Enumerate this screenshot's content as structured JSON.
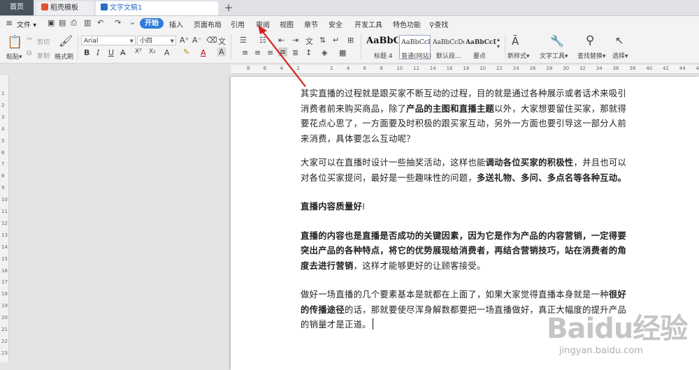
{
  "tabs": {
    "home": "首页",
    "templates": "稻壳模板",
    "document": "文字文稿1",
    "new_tab": "+"
  },
  "menu": {
    "file": "文件",
    "items": [
      "开始",
      "插入",
      "页面布局",
      "引用",
      "审阅",
      "视图",
      "章节",
      "安全",
      "开发工具",
      "特色功能"
    ],
    "search": "查找"
  },
  "ribbon": {
    "paste": "粘贴",
    "cut": "剪切",
    "copy": "复制",
    "format_painter": "格式刷",
    "font_name": "Arial",
    "font_size": "小四",
    "bold": "B",
    "italic": "I",
    "underline": "U",
    "styles": [
      {
        "sample": "AaBbC",
        "label": "标题 4"
      },
      {
        "sample": "AaBbCcD",
        "label": "普通(网站)"
      },
      {
        "sample": "AaBbCcDd",
        "label": "默认段..."
      },
      {
        "sample": "AaBbCcDc",
        "label": "要点"
      }
    ],
    "new_style": "新样式",
    "text_tools": "文字工具",
    "find_replace": "查找替换",
    "select": "选择"
  },
  "ruler": {
    "h_numbers": [
      "8",
      "6",
      "4",
      "2",
      "",
      "2",
      "4",
      "6",
      "8",
      "10",
      "12",
      "14",
      "16",
      "18",
      "20",
      "22",
      "24",
      "26",
      "28",
      "30",
      "32",
      "34",
      "36",
      "38",
      "40",
      "42",
      "44",
      "46"
    ],
    "v_numbers": [
      "1",
      "2",
      "3",
      "4",
      "5",
      "6",
      "7",
      "8",
      "9",
      "10",
      "11",
      "12",
      "13",
      "14",
      "15",
      "16",
      "17",
      "18",
      "19",
      "20",
      "21",
      "22",
      "23"
    ]
  },
  "document": {
    "p1": "其实直播的过程就是跟买家不断互动的过程，目的就是通过各种展示或者话术来吸引消费者前来购买商品，除了",
    "p1_b1": "产品的主图和直播主题",
    "p1_c": "以外，大家想要留住买家，那就得要花点心思了，一方面要及时积极的跟买家互动，另外一方面也要引导这一部分人前来消费，具体要怎么互动呢？",
    "p2": "大家可以在直播时设计一些抽奖活动，这样也能",
    "p2_b1": "调动各位买家的积极性",
    "p2_c": "，并且也可以对各位买家提问，最好是一些趣味性的问题，",
    "p2_b2": "多送礼物、多问、多点名等各种互动。",
    "heading": "直播内容质量好",
    "p3_b": "直播的内容也是直播是否成功的关键因素，因为它是作为产品的内容营销，一定得要突出产品的各种特点，将它的优势展现给消费者，再结合营销技巧，站在消费者的角度去进行营销",
    "p3_c": "，这样才能够更好的让顾客接受。",
    "p4": "做好一场直播的几个要素基本是就都在上面了，如果大家觉得直播本身就是一种",
    "p4_b": "很好的传播途径",
    "p4_c": "的话，那就要使尽浑身解数都要把一场直播做好，真正大幅度的提升产品的销量才是正道。"
  },
  "watermark": {
    "title": "Baidu经验",
    "url": "jingyan.baidu.com"
  },
  "colors": {
    "accent": "#2f7ddb",
    "arrow": "#d81e1e"
  }
}
